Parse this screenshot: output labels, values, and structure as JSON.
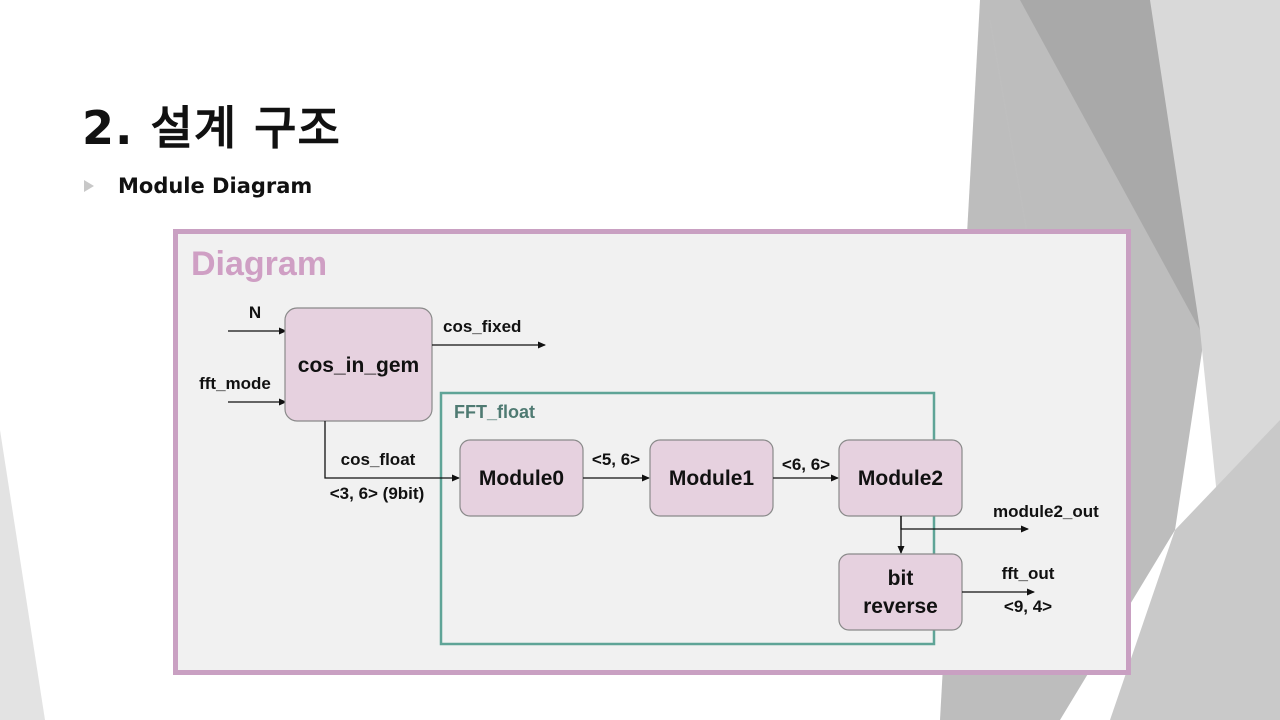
{
  "slide": {
    "title": "2. 설계 구조",
    "bullet": "Module Diagram"
  },
  "diagram": {
    "title": "Diagram",
    "inputs": {
      "n": "N",
      "fft_mode": "fft_mode"
    },
    "blocks": {
      "cos_in_gem": "cos_in_gem",
      "module0": "Module0",
      "module1": "Module1",
      "module2": "Module2",
      "bit_reverse_line1": "bit",
      "bit_reverse_line2": "reverse"
    },
    "group": {
      "label": "FFT_float"
    },
    "signals": {
      "cos_fixed": "cos_fixed",
      "cos_float": "cos_float",
      "cos_float_format": "<3, 6> (9bit)",
      "m0_m1_format": "<5, 6>",
      "m1_m2_format": "<6, 6>",
      "module2_out": "module2_out",
      "fft_out": "fft_out",
      "fft_out_format": "<9, 4>"
    },
    "colors": {
      "frame": "#c9a0c2",
      "title": "#cf9fc4",
      "block_fill": "#e6d1df",
      "block_stroke": "#8a8a8a",
      "group_border": "#5fa497",
      "group_label": "#4f7a72",
      "panel_fill": "#f1f1f1"
    }
  }
}
